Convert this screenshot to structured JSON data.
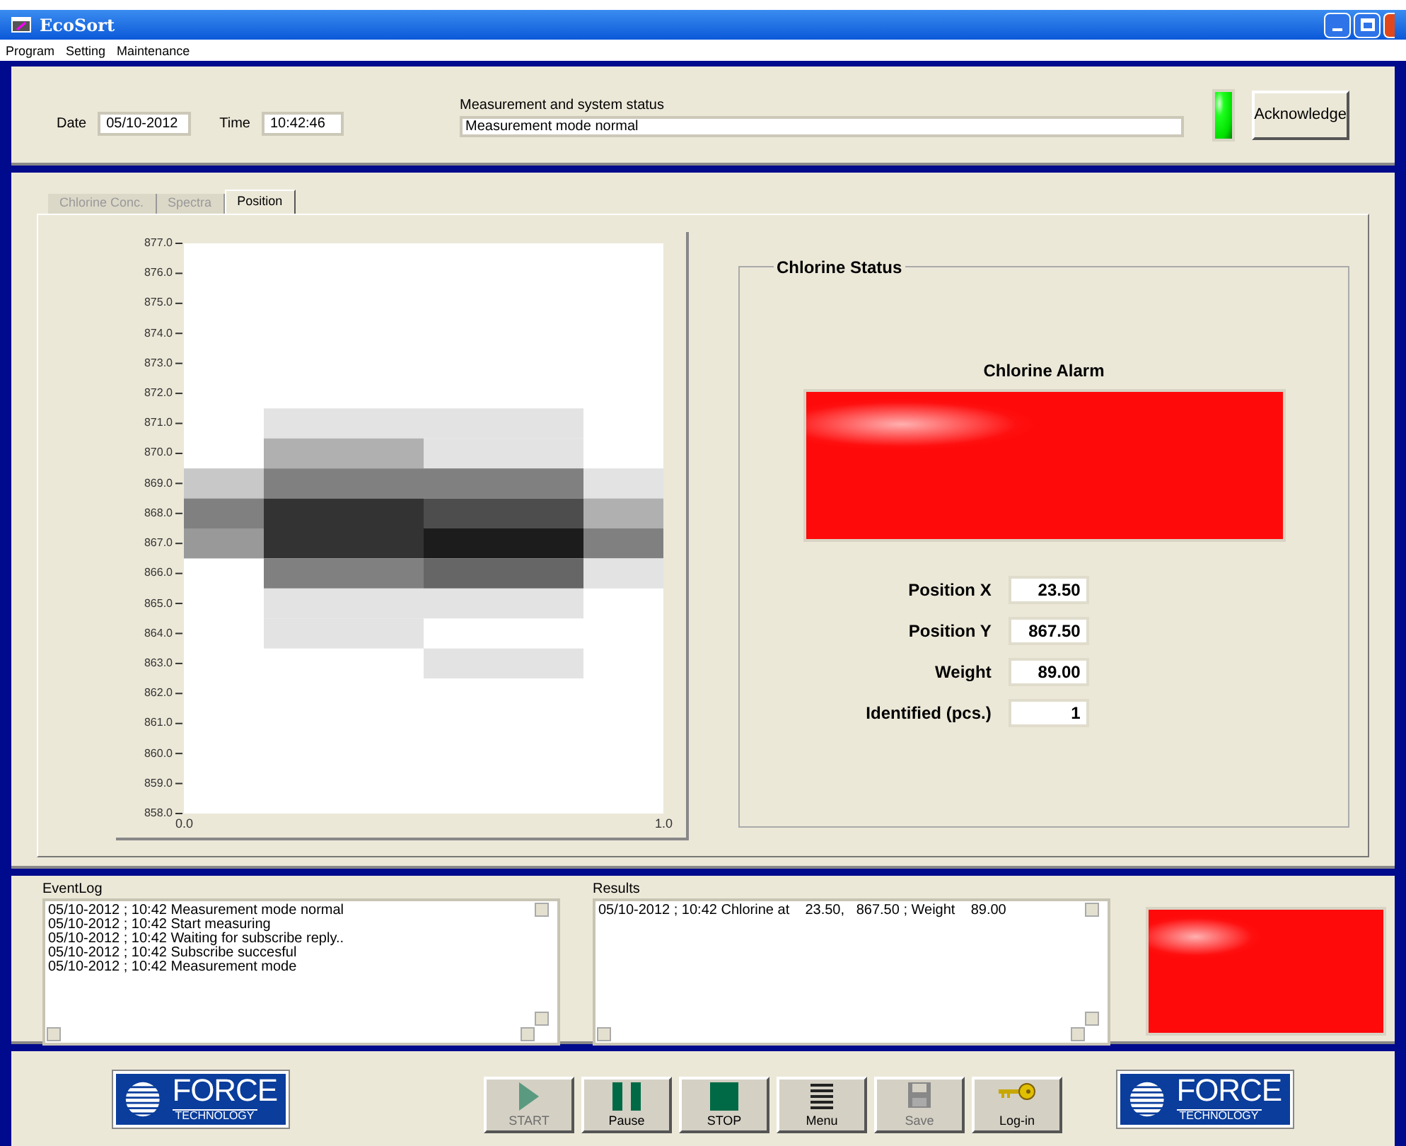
{
  "window": {
    "title": "EcoSort"
  },
  "menu": [
    "Program",
    "Setting",
    "Maintenance"
  ],
  "header": {
    "date_label": "Date",
    "date": "05/10-2012",
    "time_label": "Time",
    "time": "10:42:46",
    "status_label": "Measurement and system status",
    "status": "Measurement mode normal",
    "status_lamp": {
      "on": true
    },
    "acknowledge": "Acknowledge"
  },
  "tabs": [
    {
      "label": "Chlorine Conc.",
      "selected": false
    },
    {
      "label": "Spectra",
      "selected": false
    },
    {
      "label": "Position",
      "selected": true
    }
  ],
  "position_plot": {
    "y_ticks": [
      "877.0",
      "876.0",
      "875.0",
      "874.0",
      "873.0",
      "872.0",
      "871.0",
      "870.0",
      "869.0",
      "868.0",
      "867.0",
      "866.0",
      "865.0",
      "864.0",
      "863.0",
      "862.0",
      "861.0",
      "860.0",
      "859.0",
      "858.0"
    ],
    "x_ticks": [
      "0.0",
      "1.0"
    ]
  },
  "chlorine_status": {
    "title": "Chlorine Status",
    "alarm_label": "Chlorine Alarm",
    "alarm_on": true,
    "fields": [
      {
        "label": "Position X",
        "value": "23.50"
      },
      {
        "label": "Position Y",
        "value": "867.50"
      },
      {
        "label": "Weight",
        "value": "89.00"
      },
      {
        "label": "Identified (pcs.)",
        "value": "1"
      }
    ]
  },
  "event_log": {
    "title": "EventLog",
    "lines": [
      "05/10-2012 ; 10:42 Measurement mode normal",
      "05/10-2012 ; 10:42 Start measuring",
      "05/10-2012 ; 10:42 Waiting for subscribe reply..",
      "05/10-2012 ; 10:42 Subscribe succesful",
      "05/10-2012 ; 10:42 Measurement mode"
    ]
  },
  "results": {
    "title": "Results",
    "lines": [
      "05/10-2012 ; 10:42 Chlorine at    23.50,   867.50 ; Weight    89.00"
    ]
  },
  "result_lamp": {
    "on": true
  },
  "logos": [
    {
      "name": "FORCE",
      "sub": "TECHNOLOGY"
    },
    {
      "name": "FORCE",
      "sub": "TECHNOLOGY"
    }
  ],
  "toolbar": [
    {
      "kind": "start",
      "label": "START",
      "disabled": true
    },
    {
      "kind": "pause",
      "label": "Pause",
      "disabled": false
    },
    {
      "kind": "stop",
      "label": "STOP",
      "disabled": false
    },
    {
      "kind": "menu",
      "label": "Menu",
      "disabled": false
    },
    {
      "kind": "save",
      "label": "Save",
      "disabled": true
    },
    {
      "kind": "login",
      "label": "Log-in",
      "disabled": false
    }
  ]
}
